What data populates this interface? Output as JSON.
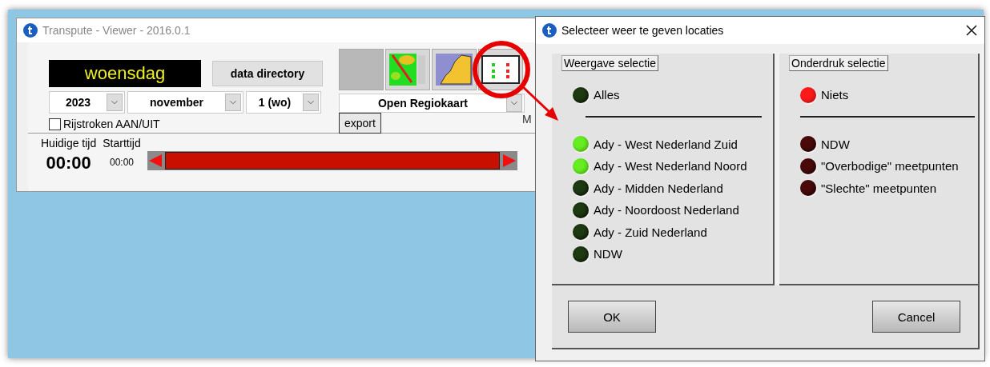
{
  "main_window": {
    "title": "Transpute - Viewer - 2016.0.1",
    "day_display": "woensdag",
    "data_directory_button": "data directory",
    "year": "2023",
    "month": "november",
    "day": "1 (wo)",
    "lanes_checkbox": {
      "label": "Rijstroken AAN/UIT",
      "checked": false
    },
    "view_buttons": [
      {
        "kind": "blank"
      },
      {
        "kind": "heatmap"
      },
      {
        "kind": "map"
      },
      {
        "kind": "locations"
      }
    ],
    "map_select": "Open Regiokaart",
    "export_button": "export",
    "cut_label": "M",
    "current_time_label": "Huidige tijd",
    "current_time": "00:00",
    "start_time_label": "Starttijd",
    "start_time": "00:00",
    "timeline": {
      "level": 1
    }
  },
  "dialog": {
    "title": "Selecteer weer te geven locaties",
    "sections": [
      {
        "title": "Weergave selectie",
        "kind": "show",
        "all": {
          "label": "Alles",
          "on": false
        },
        "items": [
          {
            "label": "Ady - West Nederland Zuid",
            "on": true
          },
          {
            "label": "Ady - West Nederland Noord",
            "on": true
          },
          {
            "label": "Ady - Midden Nederland",
            "on": false
          },
          {
            "label": "Ady - Noordoost Nederland",
            "on": false
          },
          {
            "label": "Ady - Zuid Nederland",
            "on": false
          },
          {
            "label": "NDW",
            "on": false
          }
        ]
      },
      {
        "title": "Onderdruk selectie",
        "kind": "suppress",
        "all": {
          "label": "Niets",
          "on": true
        },
        "items": [
          {
            "label": "NDW",
            "on": false
          },
          {
            "label": "\"Overbodige\" meetpunten",
            "on": false
          },
          {
            "label": "\"Slechte\" meetpunten",
            "on": false
          }
        ]
      }
    ],
    "buttons": [
      {
        "label": "OK"
      },
      {
        "label": "Cancel"
      }
    ]
  }
}
